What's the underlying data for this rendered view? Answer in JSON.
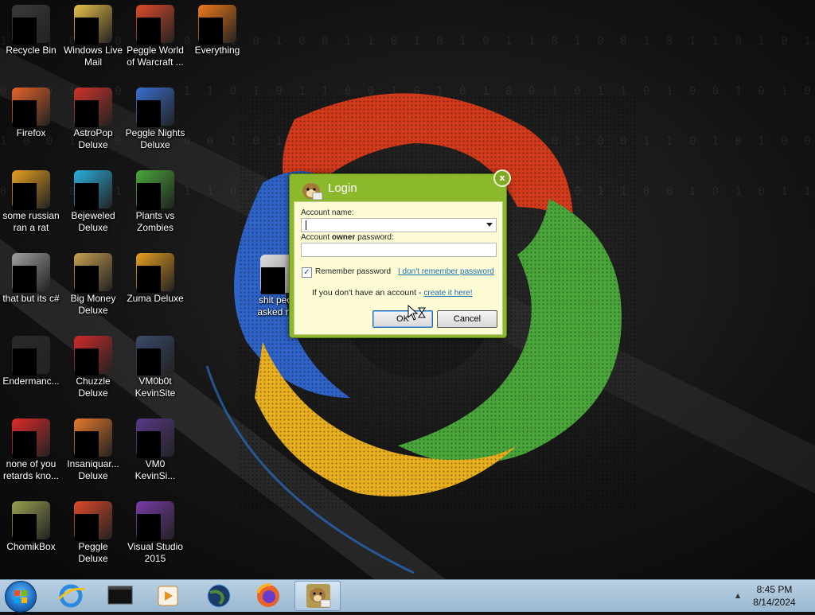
{
  "desktop": {
    "icons": [
      {
        "label": "Recycle Bin",
        "icon": "recycle-bin-icon",
        "color": "#3a3a3a"
      },
      {
        "label": "Windows Live Mail",
        "icon": "mail-icon",
        "color": "#e8c048"
      },
      {
        "label": "Peggle World of Warcraft ...",
        "icon": "peggle-icon",
        "color": "#e04a2a"
      },
      {
        "label": "Everything",
        "icon": "search-everything-icon",
        "color": "#f07a1a"
      },
      {
        "label": "Firefox",
        "icon": "firefox-icon",
        "color": "#e8632a"
      },
      {
        "label": "AstroPop Deluxe",
        "icon": "astropop-icon",
        "color": "#d0342a"
      },
      {
        "label": "Peggle Nights Deluxe",
        "icon": "peggle-nights-icon",
        "color": "#3a6fd0"
      },
      {
        "label": "some russian ran a rat",
        "icon": "rat-icon",
        "color": "#e8a020"
      },
      {
        "label": "Bejeweled Deluxe",
        "icon": "bejeweled-icon",
        "color": "#2ab0e0"
      },
      {
        "label": "Plants vs Zombies",
        "icon": "plants-icon",
        "color": "#4aa83a"
      },
      {
        "label": "that but its c#",
        "icon": "window-stack-icon",
        "color": "#a0a0a0"
      },
      {
        "label": "Big Money Deluxe",
        "icon": "money-bag-icon",
        "color": "#c8a050"
      },
      {
        "label": "Zuma Deluxe",
        "icon": "zuma-icon",
        "color": "#e8a020"
      },
      {
        "label": "Endermanc...",
        "icon": "terminal-icon",
        "color": "#2a2a2a"
      },
      {
        "label": "Chuzzle Deluxe",
        "icon": "chuzzle-icon",
        "color": "#d02a2a"
      },
      {
        "label": "VM0b0t KevinSite",
        "icon": "vm-icon",
        "color": "#3a4a6a"
      },
      {
        "label": "none of you retards kno...",
        "icon": "opera-icon",
        "color": "#e02a2a"
      },
      {
        "label": "Insaniquar... Deluxe",
        "icon": "fish-icon",
        "color": "#e87a2a"
      },
      {
        "label": "VM0 KevinSi...",
        "icon": "vm-icon",
        "color": "#5a3a8a"
      },
      {
        "label": "ChomikBox",
        "icon": "chomikbox-icon",
        "color": "#9aa050"
      },
      {
        "label": "Peggle Deluxe",
        "icon": "peggle-icon",
        "color": "#e04a2a"
      },
      {
        "label": "Visual Studio 2015",
        "icon": "visual-studio-icon",
        "color": "#7a3aa8"
      }
    ],
    "extra_icon": {
      "label": "shit peo... asked m...",
      "icon": "file-icon"
    }
  },
  "dialog": {
    "title": "Login",
    "close_glyph": "x",
    "account_name_label": "Account name:",
    "password_label_prefix": "Account ",
    "password_label_bold": "owner",
    "password_label_suffix": " password:",
    "remember_label": "Remember password",
    "remember_checked": true,
    "forgot_link": "I don't remember password",
    "no_account_text": "If you don't have an account - ",
    "create_link": "create it here!",
    "ok_label": "OK",
    "cancel_label": "Cancel",
    "accent_color": "#8cb82c"
  },
  "taskbar": {
    "items": [
      {
        "icon": "start-orb-icon"
      },
      {
        "icon": "internet-explorer-icon"
      },
      {
        "icon": "terminal-icon"
      },
      {
        "icon": "media-player-icon"
      },
      {
        "icon": "globe-icon"
      },
      {
        "icon": "firefox-icon"
      },
      {
        "icon": "chomikbox-icon",
        "active": true
      }
    ],
    "time": "8:45 PM",
    "date": "8/14/2024"
  }
}
